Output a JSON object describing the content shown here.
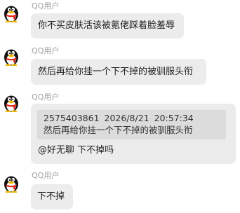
{
  "messages": [
    {
      "sender": "QQ用户",
      "avatar_icon": "qq-penguin-avatar-icon",
      "text": "你不买皮肤活该被氪佬踩着脸羞辱"
    },
    {
      "sender": "QQ用户",
      "avatar_icon": "qq-penguin-avatar-icon",
      "text": "然后再给你挂一个下不掉的被驯服头衔"
    },
    {
      "sender": "QQ用户",
      "avatar_icon": "qq-penguin-avatar-icon",
      "quote": {
        "qq_number": "2575403861",
        "date": "2026/8/21",
        "time": "20:57:34",
        "text": "然后再给你挂一个下不掉的被驯服头衔"
      },
      "text": "@好无聊 下不掉吗"
    },
    {
      "sender": "QQ用户",
      "avatar_icon": "qq-penguin-avatar-icon",
      "text": "下不掉"
    }
  ],
  "colors": {
    "bubble": "#ececec",
    "quote_background": "#dcdcdc",
    "sender_name": "#a0a0a0",
    "text": "#1f1f1f"
  }
}
